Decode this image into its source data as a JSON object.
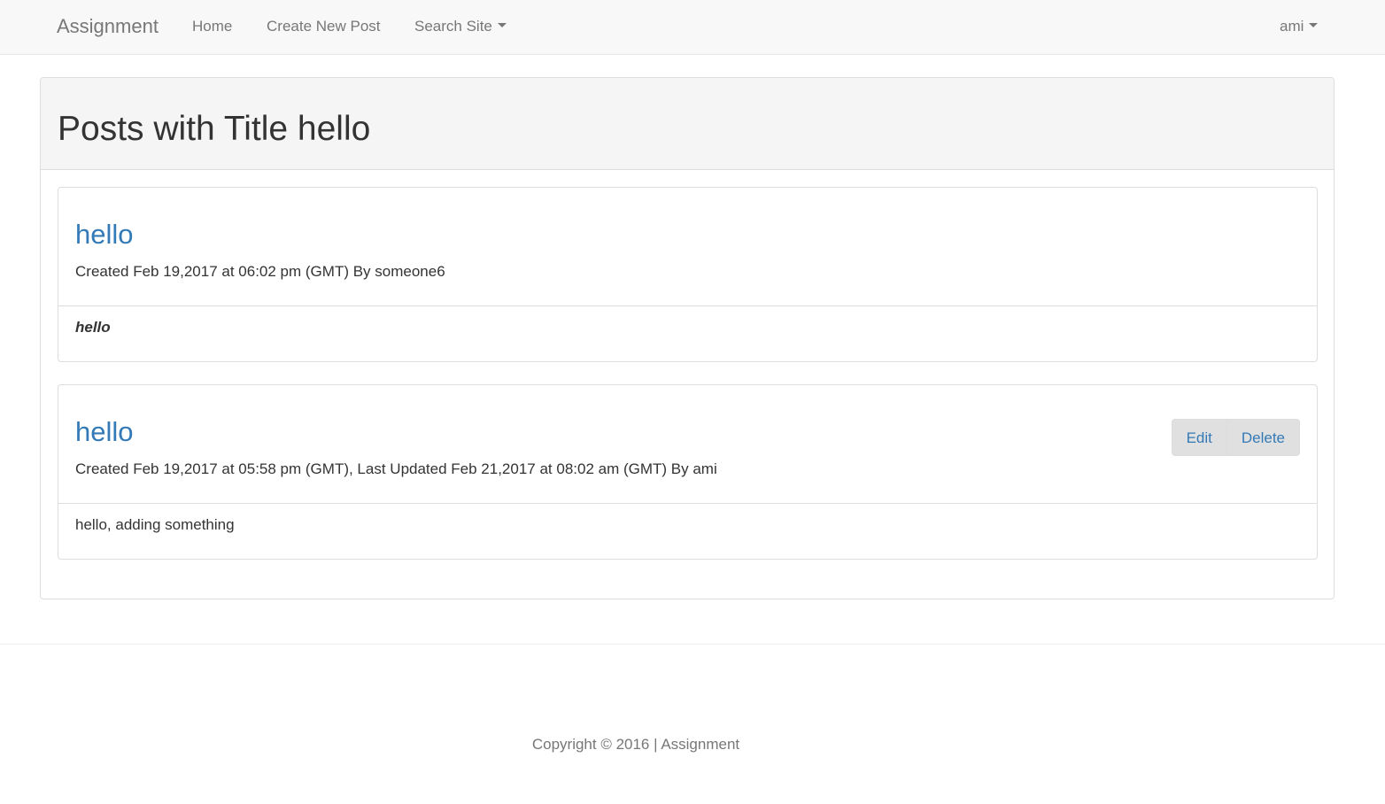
{
  "navbar": {
    "brand": "Assignment",
    "links": {
      "home": "Home",
      "create": "Create New Post",
      "search": "Search Site"
    },
    "user": "ami"
  },
  "page": {
    "title": "Posts with Title hello"
  },
  "posts": [
    {
      "title": "hello",
      "meta": "Created Feb 19,2017 at 06:02 pm (GMT) By someone6",
      "body": "hello"
    },
    {
      "title": "hello",
      "meta": "Created Feb 19,2017 at 05:58 pm (GMT), Last Updated Feb 21,2017 at 08:02 am (GMT) By ami",
      "body": "hello, adding something",
      "actions": {
        "edit": "Edit",
        "delete": "Delete"
      }
    }
  ],
  "footer": {
    "text": "Copyright © 2016 | Assignment"
  },
  "colors": {
    "link": "#337ab7",
    "navbar_bg": "#f8f8f8",
    "panel_heading_bg": "#f5f5f5",
    "button_bg": "#e0e0e0"
  }
}
